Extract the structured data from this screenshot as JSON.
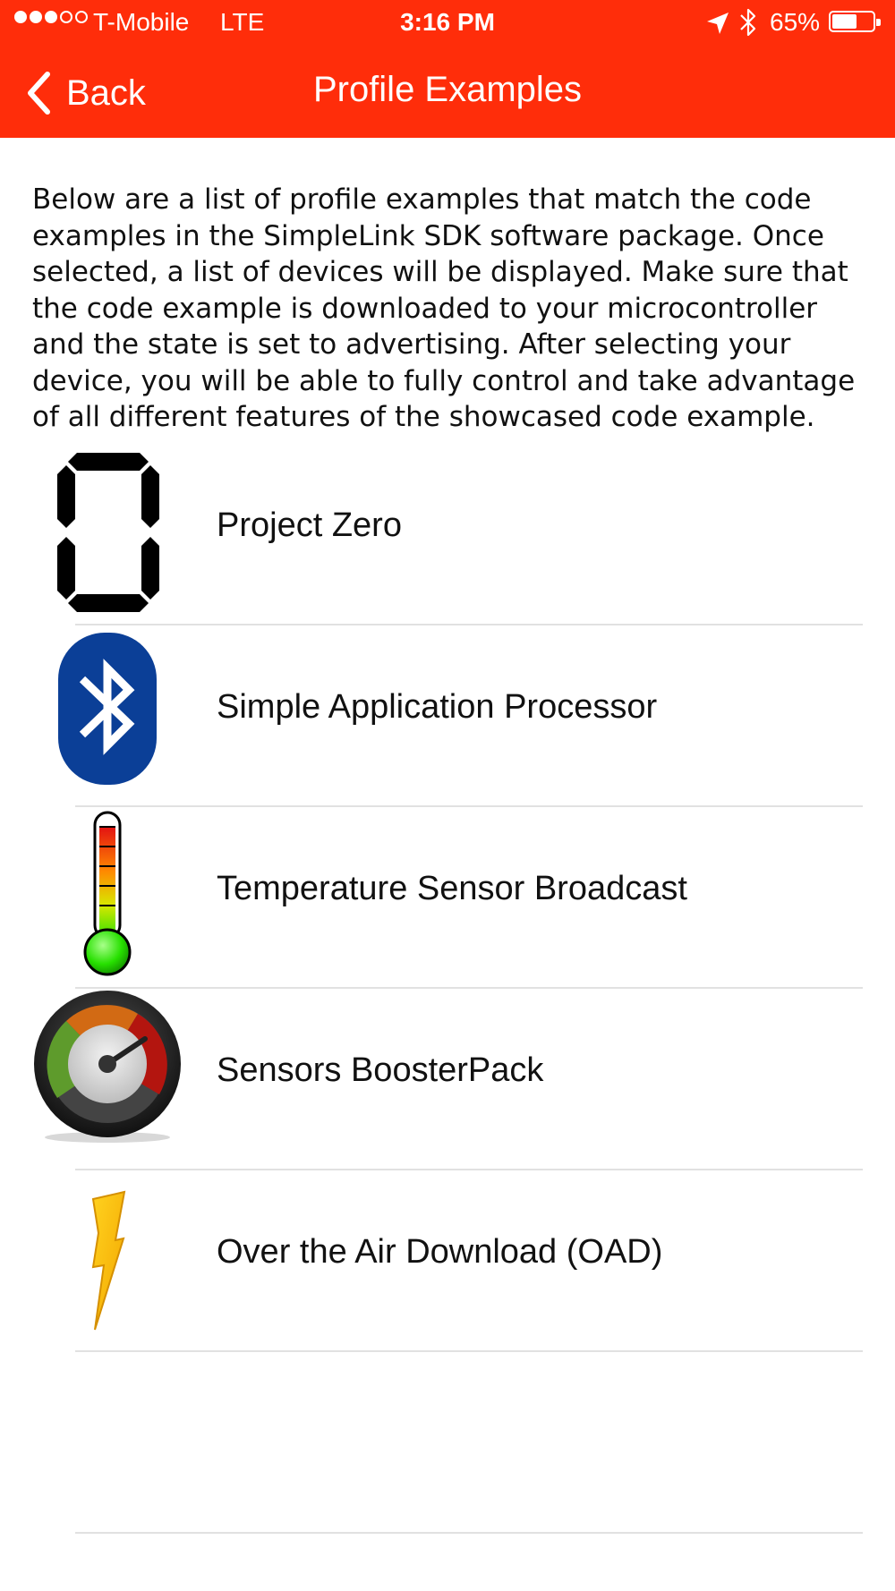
{
  "status_bar": {
    "signal_bars": 3,
    "signal_total": 5,
    "carrier": "T-Mobile",
    "network": "LTE",
    "time": "3:16 PM",
    "battery_percent": "65%",
    "battery_level": 0.65
  },
  "nav": {
    "back_label": "Back",
    "title": "Profile Examples"
  },
  "intro_text": "Below  are a list of profile examples that match the code examples in the SimpleLink SDK software package. Once selected, a list of devices will be displayed. Make sure that the code example is downloaded to your microcontroller and the state is set to advertising. After selecting your device, you will be able to fully control and take advantage of all different features of the showcased code example.",
  "profiles": [
    {
      "label": "Project Zero",
      "icon": "seven-segment-zero-icon"
    },
    {
      "label": "Simple Application Processor",
      "icon": "bluetooth-icon"
    },
    {
      "label": "Temperature Sensor Broadcast",
      "icon": "thermometer-icon"
    },
    {
      "label": "Sensors BoosterPack",
      "icon": "gauge-icon"
    },
    {
      "label": "Over the Air Download (OAD)",
      "icon": "lightning-bolt-icon"
    }
  ],
  "colors": {
    "accent": "#ff2d0a",
    "bluetooth": "#0b3f97",
    "separator": "#e1e1e1"
  }
}
